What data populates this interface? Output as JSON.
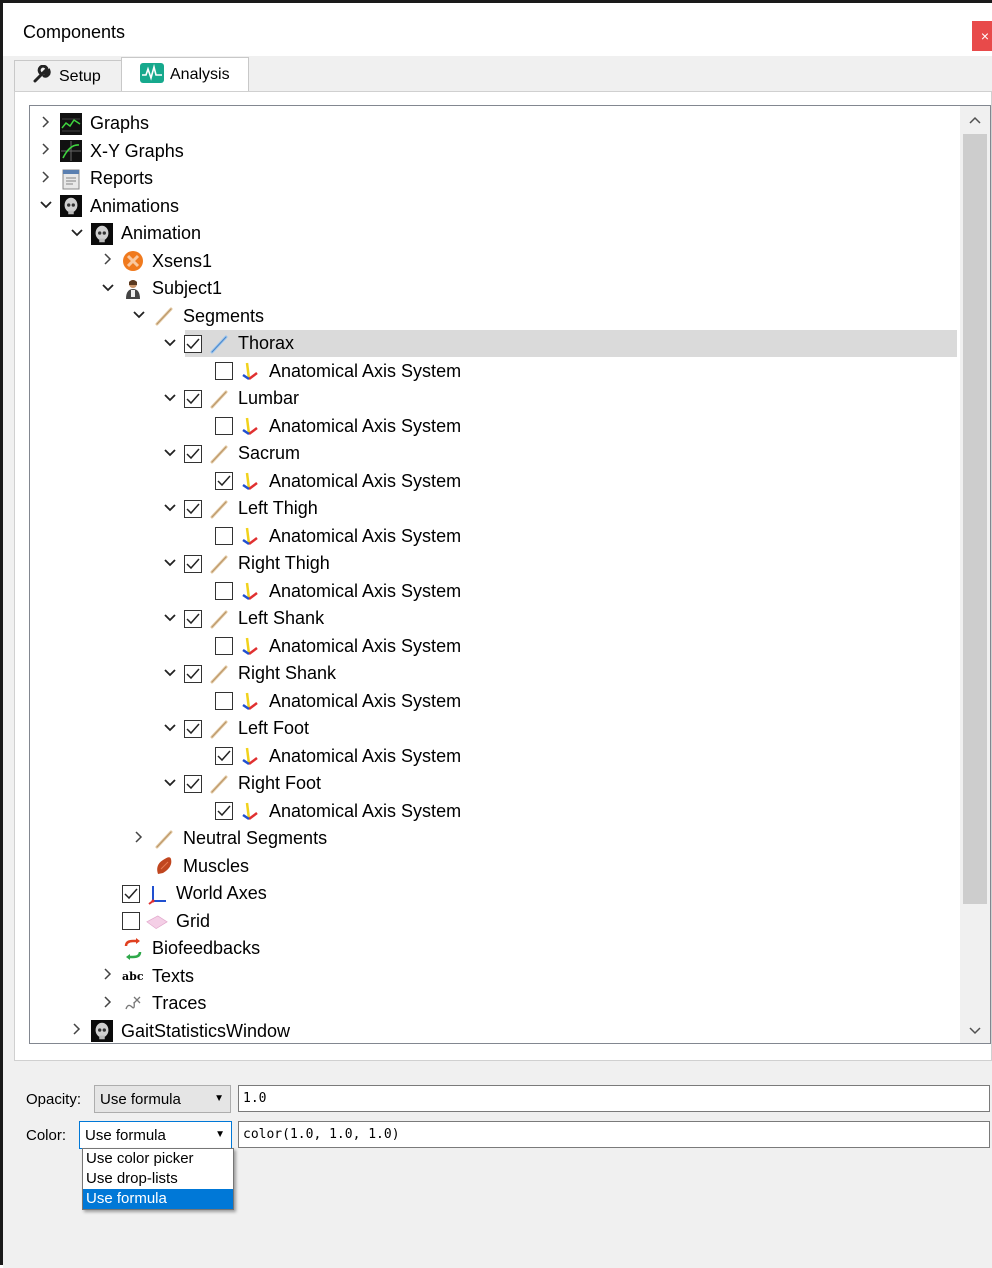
{
  "window": {
    "title": "Components",
    "close_glyph": "×"
  },
  "tabs": [
    {
      "label": "Setup",
      "icon": "wrench-icon"
    },
    {
      "label": "Analysis",
      "icon": "waveform-icon",
      "active": true
    }
  ],
  "tree": [
    {
      "label": "Graphs",
      "icon": "graph-icon",
      "expand": "collapsed",
      "level": 0
    },
    {
      "label": "X-Y Graphs",
      "icon": "xy-graph-icon",
      "expand": "collapsed",
      "level": 0
    },
    {
      "label": "Reports",
      "icon": "report-icon",
      "expand": "collapsed",
      "level": 0
    },
    {
      "label": "Animations",
      "icon": "skull-icon",
      "expand": "expanded",
      "level": 0
    },
    {
      "label": "Animation",
      "icon": "skull-icon",
      "expand": "expanded",
      "level": 1
    },
    {
      "label": "Xsens1",
      "icon": "xsens-icon",
      "expand": "collapsed",
      "level": 2
    },
    {
      "label": "Subject1",
      "icon": "person-icon",
      "expand": "expanded",
      "level": 2
    },
    {
      "label": "Segments",
      "icon": "bone-icon",
      "expand": "expanded",
      "level": 3
    },
    {
      "label": "Thorax",
      "icon": "bone-blue-icon",
      "expand": "expanded",
      "level": 4,
      "checked": true,
      "selected": true
    },
    {
      "label": "Anatomical Axis System",
      "icon": "axis-icon",
      "expand": "none",
      "level": 5,
      "checked": false
    },
    {
      "label": "Lumbar",
      "icon": "bone-icon",
      "expand": "expanded",
      "level": 4,
      "checked": true
    },
    {
      "label": "Anatomical Axis System",
      "icon": "axis-icon",
      "expand": "none",
      "level": 5,
      "checked": false
    },
    {
      "label": "Sacrum",
      "icon": "bone-icon",
      "expand": "expanded",
      "level": 4,
      "checked": true
    },
    {
      "label": "Anatomical Axis System",
      "icon": "axis-icon",
      "expand": "none",
      "level": 5,
      "checked": true
    },
    {
      "label": "Left Thigh",
      "icon": "bone-icon",
      "expand": "expanded",
      "level": 4,
      "checked": true
    },
    {
      "label": "Anatomical Axis System",
      "icon": "axis-icon",
      "expand": "none",
      "level": 5,
      "checked": false
    },
    {
      "label": "Right Thigh",
      "icon": "bone-icon",
      "expand": "expanded",
      "level": 4,
      "checked": true
    },
    {
      "label": "Anatomical Axis System",
      "icon": "axis-icon",
      "expand": "none",
      "level": 5,
      "checked": false
    },
    {
      "label": "Left Shank",
      "icon": "bone-icon",
      "expand": "expanded",
      "level": 4,
      "checked": true
    },
    {
      "label": "Anatomical Axis System",
      "icon": "axis-icon",
      "expand": "none",
      "level": 5,
      "checked": false
    },
    {
      "label": "Right Shank",
      "icon": "bone-icon",
      "expand": "expanded",
      "level": 4,
      "checked": true
    },
    {
      "label": "Anatomical Axis System",
      "icon": "axis-icon",
      "expand": "none",
      "level": 5,
      "checked": false
    },
    {
      "label": "Left Foot",
      "icon": "bone-icon",
      "expand": "expanded",
      "level": 4,
      "checked": true
    },
    {
      "label": "Anatomical Axis System",
      "icon": "axis-icon",
      "expand": "none",
      "level": 5,
      "checked": true
    },
    {
      "label": "Right Foot",
      "icon": "bone-icon",
      "expand": "expanded",
      "level": 4,
      "checked": true
    },
    {
      "label": "Anatomical Axis System",
      "icon": "axis-icon",
      "expand": "none",
      "level": 5,
      "checked": true
    },
    {
      "label": "Neutral Segments",
      "icon": "bone-icon",
      "expand": "collapsed",
      "level": 3
    },
    {
      "label": "Muscles",
      "icon": "muscle-icon",
      "expand": "none",
      "level": 3
    },
    {
      "label": "World Axes",
      "icon": "world-axes-icon",
      "expand": "none",
      "level": 2,
      "checked": true
    },
    {
      "label": "Grid",
      "icon": "grid-icon",
      "expand": "none",
      "level": 2,
      "checked": false
    },
    {
      "label": "Biofeedbacks",
      "icon": "biofeedback-icon",
      "expand": "none",
      "level": 2
    },
    {
      "label": "Texts",
      "icon": "abc-icon",
      "expand": "collapsed",
      "level": 2
    },
    {
      "label": "Traces",
      "icon": "traces-icon",
      "expand": "collapsed",
      "level": 2
    },
    {
      "label": "GaitStatisticsWindow",
      "icon": "skull-icon",
      "expand": "collapsed",
      "level": 1
    }
  ],
  "scrollbar": {
    "up_glyph": "^",
    "down_glyph": "v"
  },
  "opacity": {
    "label": "Opacity:",
    "mode": "Use formula",
    "value": "1.0"
  },
  "color": {
    "label": "Color:",
    "mode": "Use formula",
    "value": "color(1.0, 1.0, 1.0)",
    "options": [
      "Use color picker",
      "Use drop-lists",
      "Use formula"
    ],
    "highlighted_option": 2
  },
  "colors": {
    "selection": "#dadada",
    "highlight": "#0078d7",
    "close": "#e84a4a"
  }
}
